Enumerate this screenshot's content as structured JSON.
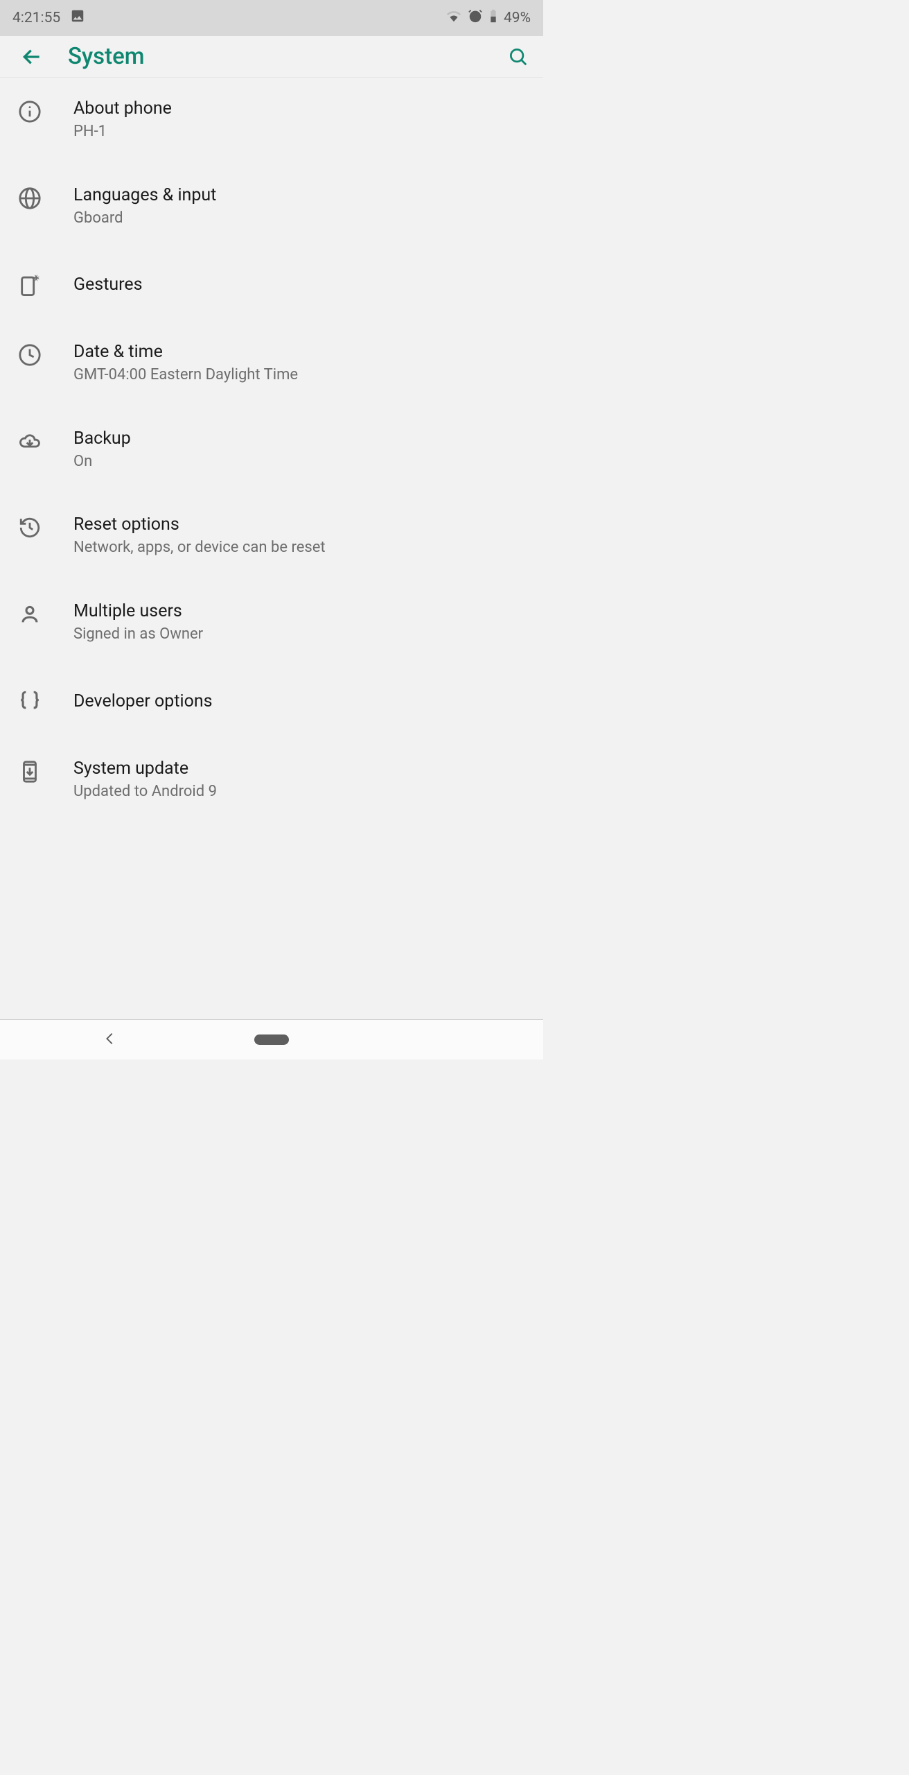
{
  "status": {
    "time": "4:21:55",
    "battery": "49%"
  },
  "header": {
    "title": "System"
  },
  "items": [
    {
      "icon": "info-icon",
      "title": "About phone",
      "subtitle": "PH-1"
    },
    {
      "icon": "globe-icon",
      "title": "Languages & input",
      "subtitle": "Gboard"
    },
    {
      "icon": "gesture-icon",
      "title": "Gestures",
      "subtitle": ""
    },
    {
      "icon": "clock-icon",
      "title": "Date & time",
      "subtitle": "GMT-04:00 Eastern Daylight Time"
    },
    {
      "icon": "cloud-download-icon",
      "title": "Backup",
      "subtitle": "On"
    },
    {
      "icon": "restore-icon",
      "title": "Reset options",
      "subtitle": "Network, apps, or device can be reset"
    },
    {
      "icon": "user-icon",
      "title": "Multiple users",
      "subtitle": "Signed in as Owner"
    },
    {
      "icon": "braces-icon",
      "title": "Developer options",
      "subtitle": ""
    },
    {
      "icon": "system-update-icon",
      "title": "System update",
      "subtitle": "Updated to Android 9"
    }
  ]
}
